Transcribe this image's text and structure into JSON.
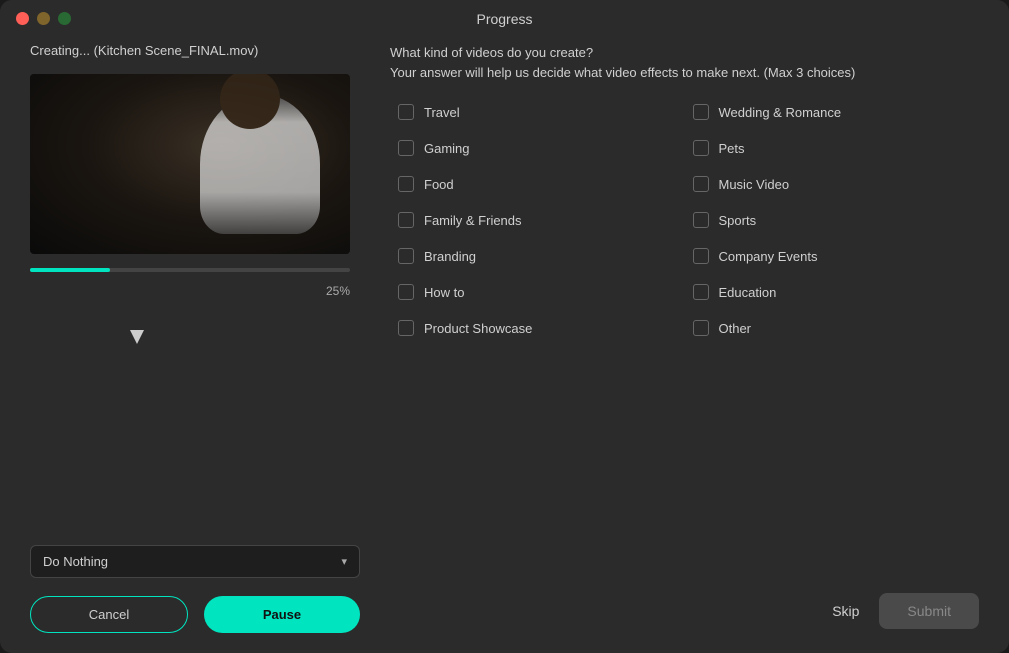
{
  "window": {
    "title": "Progress"
  },
  "left": {
    "creating_label": "Creating... (Kitchen Scene_FINAL.mov)",
    "progress_percent": "25%",
    "dropdown_label": "Do Nothing",
    "btn_cancel": "Cancel",
    "btn_pause": "Pause"
  },
  "right": {
    "question_line1": "What kind of videos do you create?",
    "question_line2": "Your answer will help us decide what video effects to make next.  (Max 3 choices)",
    "checkboxes_col1": [
      {
        "id": "travel",
        "label": "Travel"
      },
      {
        "id": "gaming",
        "label": "Gaming"
      },
      {
        "id": "food",
        "label": "Food"
      },
      {
        "id": "family",
        "label": "Family & Friends"
      },
      {
        "id": "branding",
        "label": "Branding"
      },
      {
        "id": "howto",
        "label": "How to"
      },
      {
        "id": "product",
        "label": "Product Showcase"
      }
    ],
    "checkboxes_col2": [
      {
        "id": "wedding",
        "label": "Wedding & Romance"
      },
      {
        "id": "pets",
        "label": "Pets"
      },
      {
        "id": "music",
        "label": "Music Video"
      },
      {
        "id": "sports",
        "label": "Sports"
      },
      {
        "id": "company",
        "label": "Company Events"
      },
      {
        "id": "education",
        "label": "Education"
      },
      {
        "id": "other",
        "label": "Other"
      }
    ],
    "btn_skip": "Skip",
    "btn_submit": "Submit"
  },
  "traffic_lights": {
    "red": "#ff5f57",
    "yellow": "#febc2e",
    "green": "#28c840"
  }
}
